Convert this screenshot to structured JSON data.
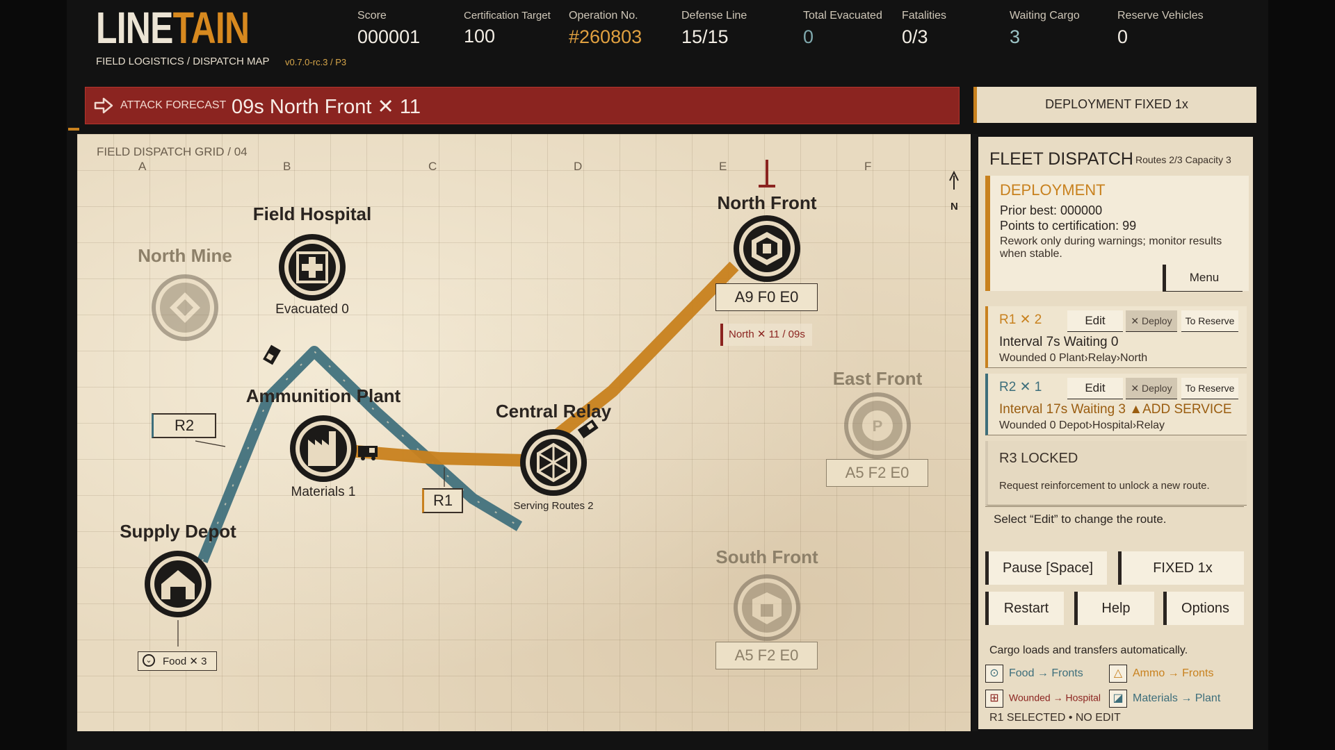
{
  "header": {
    "logo_main": "LINE",
    "logo_accent": "TAIN",
    "subtitle": "FIELD LOGISTICS / DISPATCH MAP",
    "version": "v0.7.0-rc.3 / P3",
    "stats": [
      {
        "label": "Score",
        "value": "000001",
        "color": "#f2ede4"
      },
      {
        "label": "Certification Target",
        "value": "100",
        "color": "#f2ede4"
      },
      {
        "label": "Operation No.",
        "value": "#260803",
        "color": "#e0a040"
      },
      {
        "label": "Defense Line",
        "value": "15/15",
        "color": "#f2ede4"
      },
      {
        "label": "Total Evacuated",
        "value": "0",
        "color": "#7fa8ad"
      },
      {
        "label": "Fatalities",
        "value": "0/3",
        "color": "#f2ede4"
      },
      {
        "label": "Waiting Cargo",
        "value": "3",
        "color": "#9cc4c6"
      },
      {
        "label": "Reserve Vehicles",
        "value": "0",
        "color": "#f2ede4"
      }
    ]
  },
  "forecast": {
    "label": "ATTACK FORECAST",
    "value": "09s  North Front ✕ 11"
  },
  "mode": {
    "label": "DEPLOYMENT  FIXED 1x"
  },
  "map": {
    "grid_title": "FIELD DISPATCH GRID / 04",
    "columns": [
      "A",
      "B",
      "C",
      "D",
      "E",
      "F"
    ],
    "compass": "N",
    "nodes": {
      "field_hospital": {
        "title": "Field Hospital",
        "sub": "Evacuated 0"
      },
      "north_mine": {
        "title": "North Mine"
      },
      "ammunition_plant": {
        "title": "Ammunition Plant",
        "sub": "Materials 1"
      },
      "central_relay": {
        "title": "Central Relay",
        "sub": "Serving Routes 2"
      },
      "north_front": {
        "title": "North Front",
        "status": "A9 F0 E0"
      },
      "east_front": {
        "title": "East Front",
        "status": "A5 F2 E0"
      },
      "south_front": {
        "title": "South Front",
        "status": "A5 F2 E0"
      },
      "supply_depot": {
        "title": "Supply Depot"
      }
    },
    "route_tags": {
      "r1": "R1",
      "r2": "R2"
    },
    "food_tag": "Food ✕ 3",
    "north_warning": "North ✕ 11 / 09s",
    "colors": {
      "route_r1": "#c8811e",
      "route_r2": "#3d6e7b",
      "paper": "#e8dac0"
    }
  },
  "panel": {
    "title": "FLEET DISPATCH",
    "meta": "Routes 2/3  Capacity 3",
    "deploy": {
      "heading": "DEPLOYMENT",
      "prior_best": "Prior best: 000000",
      "points": "Points to certification: 99",
      "note": "Rework only during warnings; monitor results when stable.",
      "menu": "Menu"
    },
    "routes": [
      {
        "name": "R1 ✕ 2",
        "edit": "Edit",
        "deploy": "✕ Deploy",
        "reserve": "To Reserve",
        "line2": "Interval 7s  Waiting 0",
        "line3": "Wounded 0    Plant›Relay›North"
      },
      {
        "name": "R2 ✕ 1",
        "edit": "Edit",
        "deploy": "✕ Deploy",
        "reserve": "To Reserve",
        "line2": "Interval 17s  Waiting 3 ▲ADD SERVICE",
        "line3": "Wounded 0    Depot›Hospital›Relay"
      }
    ],
    "r3": {
      "name": "R3  LOCKED",
      "note": "Request reinforcement to unlock a new route."
    },
    "hint": "Select “Edit” to change the route.",
    "buttons": {
      "pause": "Pause [Space]",
      "fixed": "FIXED 1x",
      "restart": "Restart",
      "help": "Help",
      "options": "Options"
    },
    "footer": "Cargo loads and transfers automatically.",
    "legend": [
      {
        "icon": "⊙",
        "text": "Food → Fronts",
        "color": "#3d6e7b"
      },
      {
        "icon": "△",
        "text": "Ammo → Fronts",
        "color": "#c8811e"
      },
      {
        "icon": "⊞",
        "text": "Wounded → Hospital",
        "color": "#8b2420"
      },
      {
        "icon": "◪",
        "text": "Materials → Plant",
        "color": "#3d6e7b"
      }
    ],
    "selected": "R1  SELECTED • NO EDIT"
  }
}
